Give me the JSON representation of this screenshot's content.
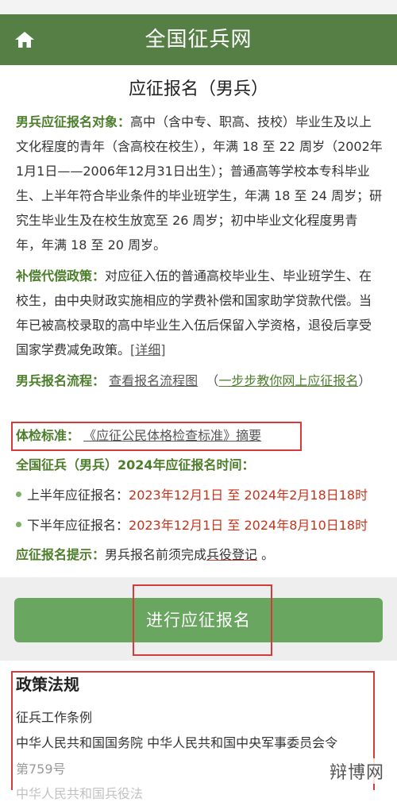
{
  "header": {
    "title": "全国征兵网",
    "home_icon": "home-icon"
  },
  "page_title": "应征报名（男兵）",
  "eligibility": {
    "label": "男兵应征报名对象：",
    "text": "高中（含中专、职高、技校）毕业生及以上文化程度的青年（含高校在校生），年满 18 至 22 周岁（2002年1月1日——2006年12月31日出生）；普通高等学校本专科毕业生、上半年符合毕业条件的毕业班学生，年满 18 至 24 周岁；研究生毕业生及在校生放宽至 26 周岁；初中毕业文化程度男青年，年满 18 至 20 周岁。"
  },
  "compensation": {
    "label": "补偿代偿政策：",
    "text": "对应征入伍的普通高校毕业生、毕业班学生、在校生，由中央财政实施相应的学费补偿和国家助学贷款代偿。当年已被高校录取的高中毕业生入伍后保留入学资格，退役后享受国家学费减免政策。",
    "detail_link": "详细"
  },
  "process": {
    "label": "男兵报名流程：",
    "link1": "查看报名流程图",
    "link2": "一步步教你网上应征报名"
  },
  "physical": {
    "label": "体检标准：",
    "link": "《应征公民体格检查标准》摘要"
  },
  "schedule": {
    "heading": "全国征兵（男兵）2024年应征报名时间：",
    "items": [
      {
        "label": "上半年应征报名：",
        "start": "2023年12月1日",
        "sep": "至",
        "end": "2024年2月18日18时"
      },
      {
        "label": "下半年应征报名：",
        "start": "2023年12月1日",
        "sep": "至",
        "end": "2024年8月10日18时"
      }
    ]
  },
  "tip": {
    "label": "应征报名提示：",
    "text": "男兵报名前须完成",
    "link": "兵役登记",
    "end": "。"
  },
  "apply_button": "进行应征报名",
  "policy": {
    "title": "政策法规",
    "items": [
      "征兵工作条例",
      "中华人民共和国国务院 中华人民共和国中央军事委员会令",
      "第759号",
      "中华人民共和国兵役法"
    ]
  },
  "watermark": "辩博网",
  "colors": {
    "header_bg": "#557f44",
    "label_green": "#4c7e2b",
    "date_red": "#c4341c",
    "button_green": "#69a660",
    "annotation_red": "#d63a3a"
  }
}
